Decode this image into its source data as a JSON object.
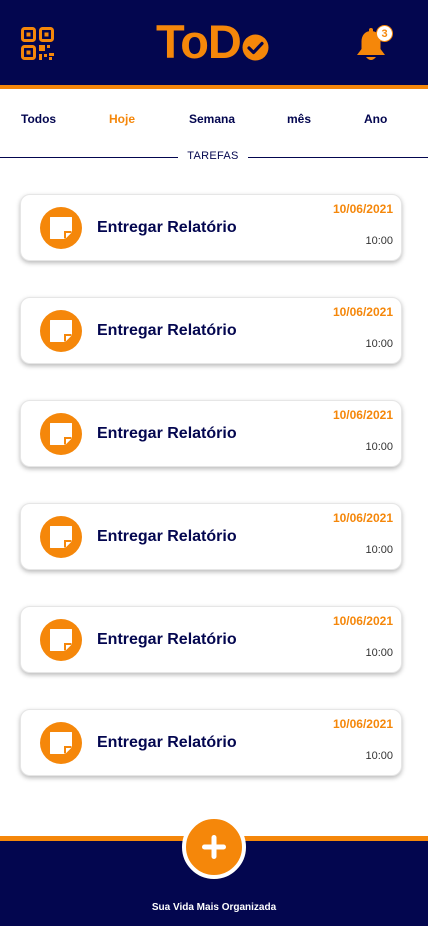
{
  "header": {
    "logo_text": "ToD",
    "notification_count": "3",
    "colors": {
      "background": "#03064f",
      "accent": "#f5870a"
    }
  },
  "tabs": [
    {
      "label": "Todos",
      "active": false
    },
    {
      "label": "Hoje",
      "active": true
    },
    {
      "label": "Semana",
      "active": false
    },
    {
      "label": "mês",
      "active": false
    },
    {
      "label": "Ano",
      "active": false
    }
  ],
  "section": {
    "title": "TAREFAS"
  },
  "tasks": [
    {
      "title": "Entregar Relatório",
      "date": "10/06/2021",
      "time": "10:00",
      "icon": "sticky-note-icon"
    },
    {
      "title": "Entregar Relatório",
      "date": "10/06/2021",
      "time": "10:00",
      "icon": "sticky-note-icon"
    },
    {
      "title": "Entregar Relatório",
      "date": "10/06/2021",
      "time": "10:00",
      "icon": "sticky-note-icon"
    },
    {
      "title": "Entregar Relatório",
      "date": "10/06/2021",
      "time": "10:00",
      "icon": "sticky-note-icon"
    },
    {
      "title": "Entregar Relatório",
      "date": "10/06/2021",
      "time": "10:00",
      "icon": "sticky-note-icon"
    },
    {
      "title": "Entregar Relatório",
      "date": "10/06/2021",
      "time": "10:00",
      "icon": "sticky-note-icon"
    }
  ],
  "footer": {
    "tagline": "Sua Vida Mais Organizada",
    "add_icon": "plus-icon"
  }
}
